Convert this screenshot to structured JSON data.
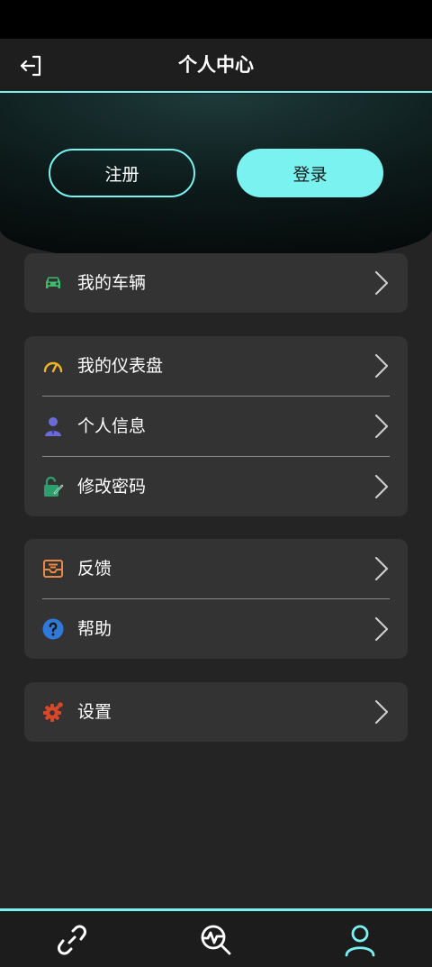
{
  "header": {
    "title": "个人中心"
  },
  "auth": {
    "register_label": "注册",
    "login_label": "登录"
  },
  "menu": {
    "vehicles": "我的车辆",
    "dashboard": "我的仪表盘",
    "profile": "个人信息",
    "change_password": "修改密码",
    "feedback": "反馈",
    "help": "帮助",
    "settings": "设置"
  },
  "colors": {
    "accent": "#7af3f0",
    "car_icon": "#3dbb6c",
    "gauge_icon": "#f0b429",
    "user_icon": "#6b6bd6",
    "lock_icon": "#2f9e6e",
    "mail_icon": "#e8894a",
    "help_icon": "#2f7ad8",
    "gear_icon": "#d9472b"
  },
  "icons": {
    "back": "logout-arrow-icon",
    "tab_connect": "link-icon",
    "tab_diagnostics": "search-chart-icon",
    "tab_profile": "user-icon"
  }
}
